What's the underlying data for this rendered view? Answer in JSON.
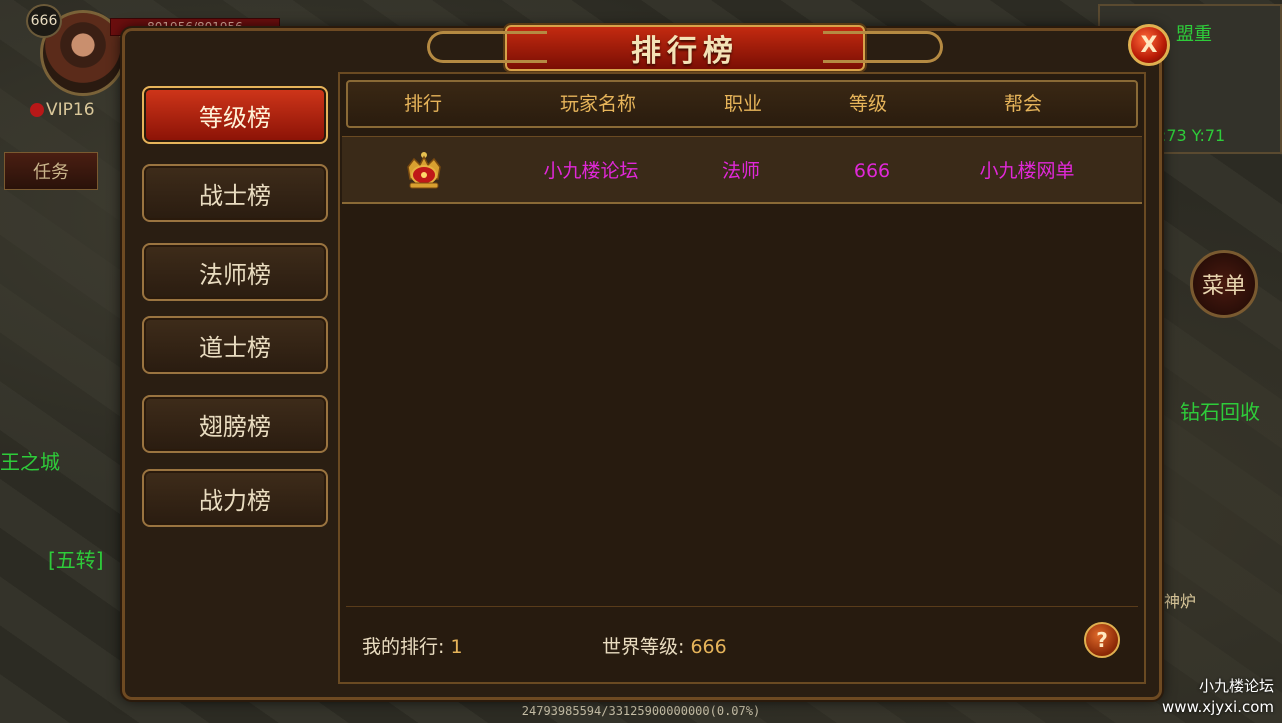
{
  "hud": {
    "level": "666",
    "hp": "801956/801956",
    "vip": "VIP16",
    "task_button": "任务",
    "menu_button": "菜单",
    "minimap_label": "盟重",
    "coords": "X:73 Y:71",
    "world_texts": [
      "王之城",
      "[五转]",
      "钻石回收",
      "神炉"
    ],
    "exp": "24793985594/33125900000000(0.07%)"
  },
  "panel": {
    "title": "排行榜",
    "close_label": "X",
    "help_label": "?"
  },
  "tabs": [
    {
      "label": "等级榜",
      "active": true
    },
    {
      "label": "战士榜",
      "active": false
    },
    {
      "label": "法师榜",
      "active": false
    },
    {
      "label": "道士榜",
      "active": false
    },
    {
      "label": "翅膀榜",
      "active": false
    },
    {
      "label": "战力榜",
      "active": false
    }
  ],
  "table": {
    "columns": [
      "排行",
      "玩家名称",
      "职业",
      "等级",
      "帮会"
    ],
    "rows": [
      {
        "rank_icon": "crown-icon",
        "name": "小九楼论坛",
        "class": "法师",
        "level": "666",
        "guild": "小九楼网单"
      }
    ]
  },
  "footer": {
    "my_rank_label": "我的排行:",
    "my_rank_value": "1",
    "world_level_label": "世界等级:",
    "world_level_value": "666"
  },
  "watermark": {
    "line1": "小九楼论坛",
    "line2": "www.xjyxi.com"
  },
  "colors": {
    "accent_gold": "#e6b45a",
    "active_tab_red": "#c32a10",
    "player_text_magenta": "#e028d8"
  }
}
